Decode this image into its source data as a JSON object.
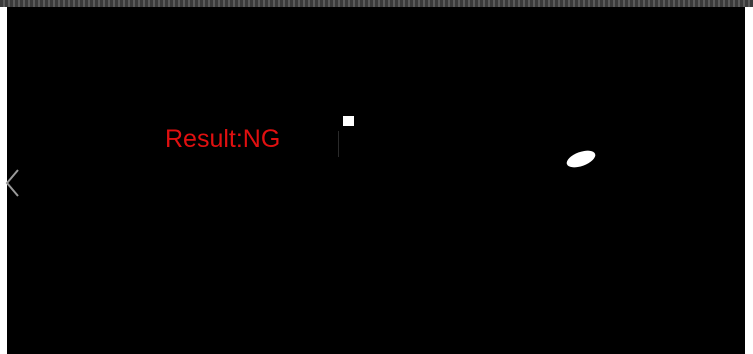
{
  "result": {
    "text": "Result:NG",
    "color": "#e01010"
  },
  "viewer": {
    "background": "#000000",
    "blob_color": "#ffffff"
  },
  "navigation": {
    "prev_icon": "chevron-left-icon",
    "icon_color": "#9a9a9a"
  }
}
